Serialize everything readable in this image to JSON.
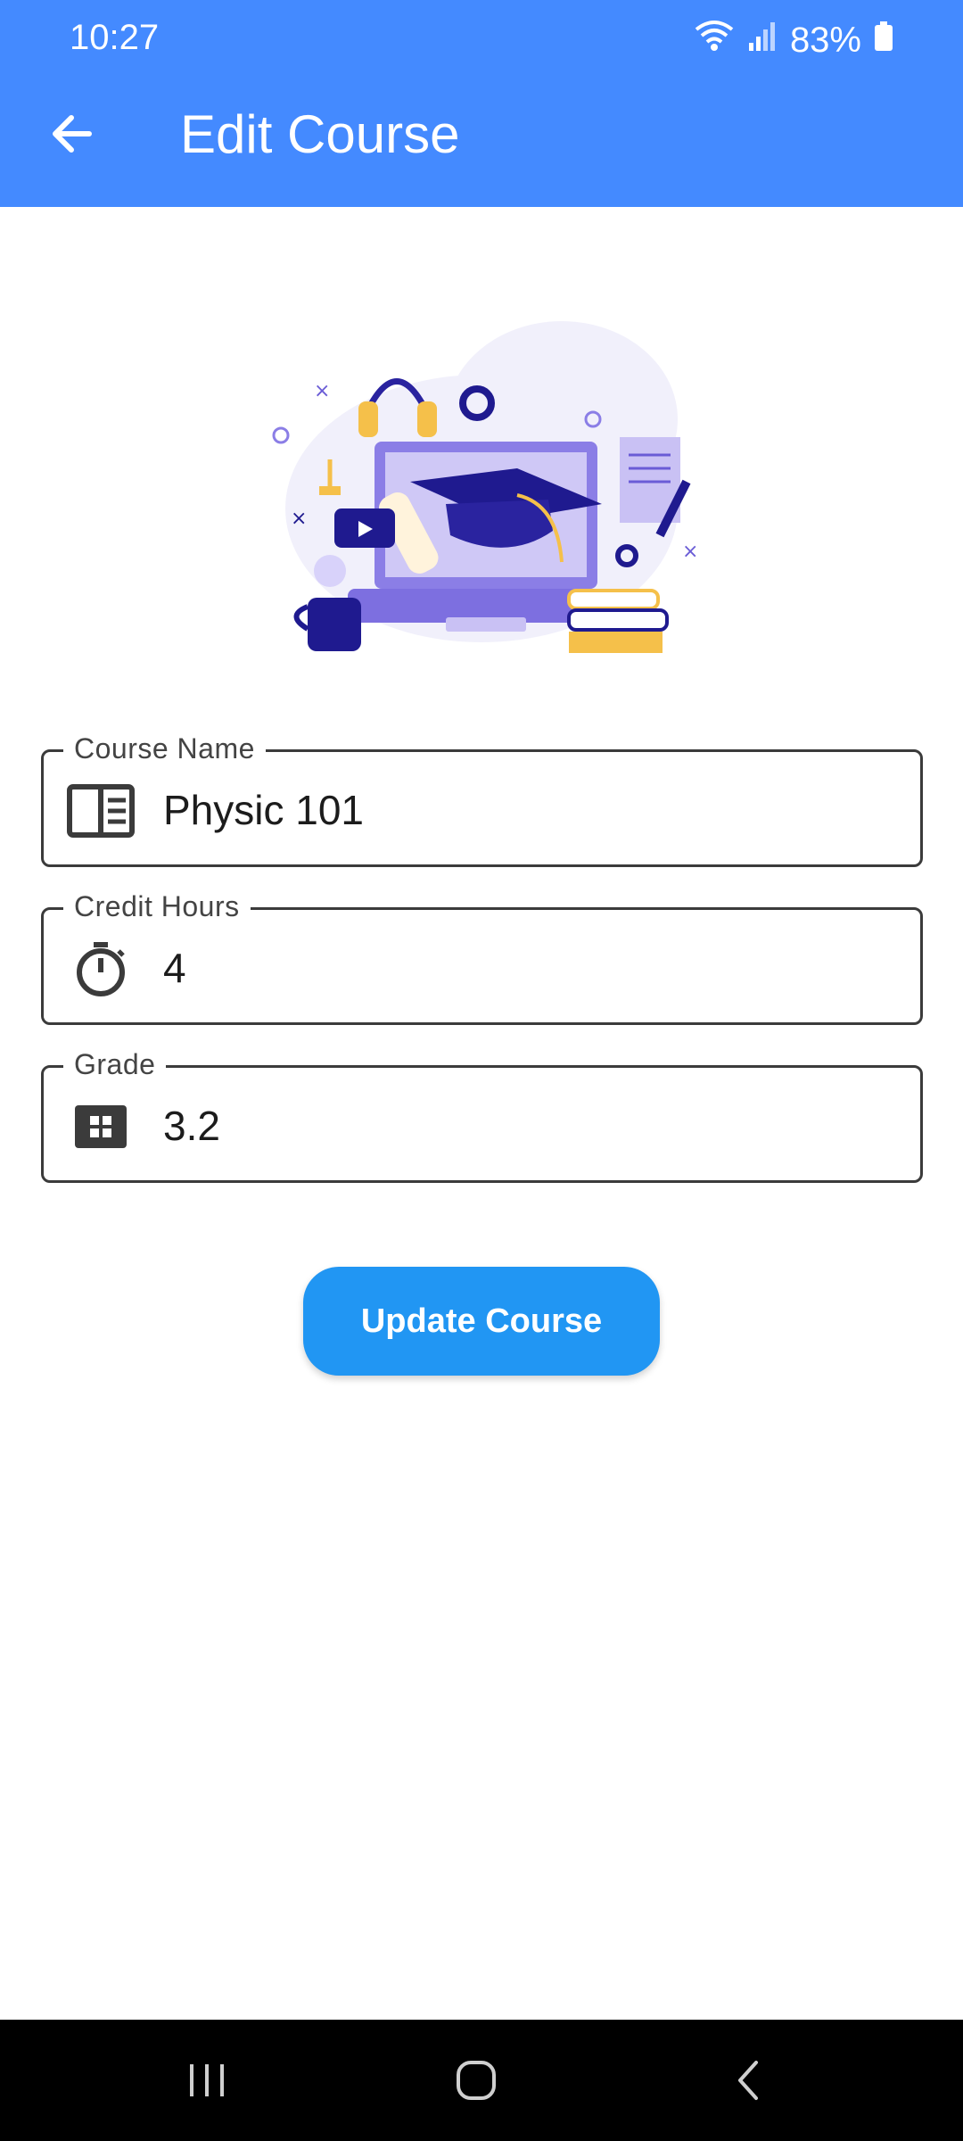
{
  "status_bar": {
    "time": "10:27",
    "battery": "83%"
  },
  "app_bar": {
    "title": "Edit Course",
    "back_icon": "arrow-left-icon"
  },
  "illustration": {
    "name": "education-illustration"
  },
  "form": {
    "course_name": {
      "label": "Course Name",
      "value": "Physic 101",
      "icon": "book-icon"
    },
    "credit_hours": {
      "label": "Credit Hours",
      "value": "4",
      "icon": "timer-icon"
    },
    "grade": {
      "label": "Grade",
      "value": "3.2",
      "icon": "grid-icon"
    }
  },
  "update_button": {
    "label": "Update Course",
    "color": "#2196f3"
  },
  "colors": {
    "app_bar": "#448aff",
    "nav_bar": "#000000"
  },
  "nav_bar": {
    "recents_icon": "recents-icon",
    "home_icon": "home-icon",
    "back_icon": "back-icon"
  }
}
